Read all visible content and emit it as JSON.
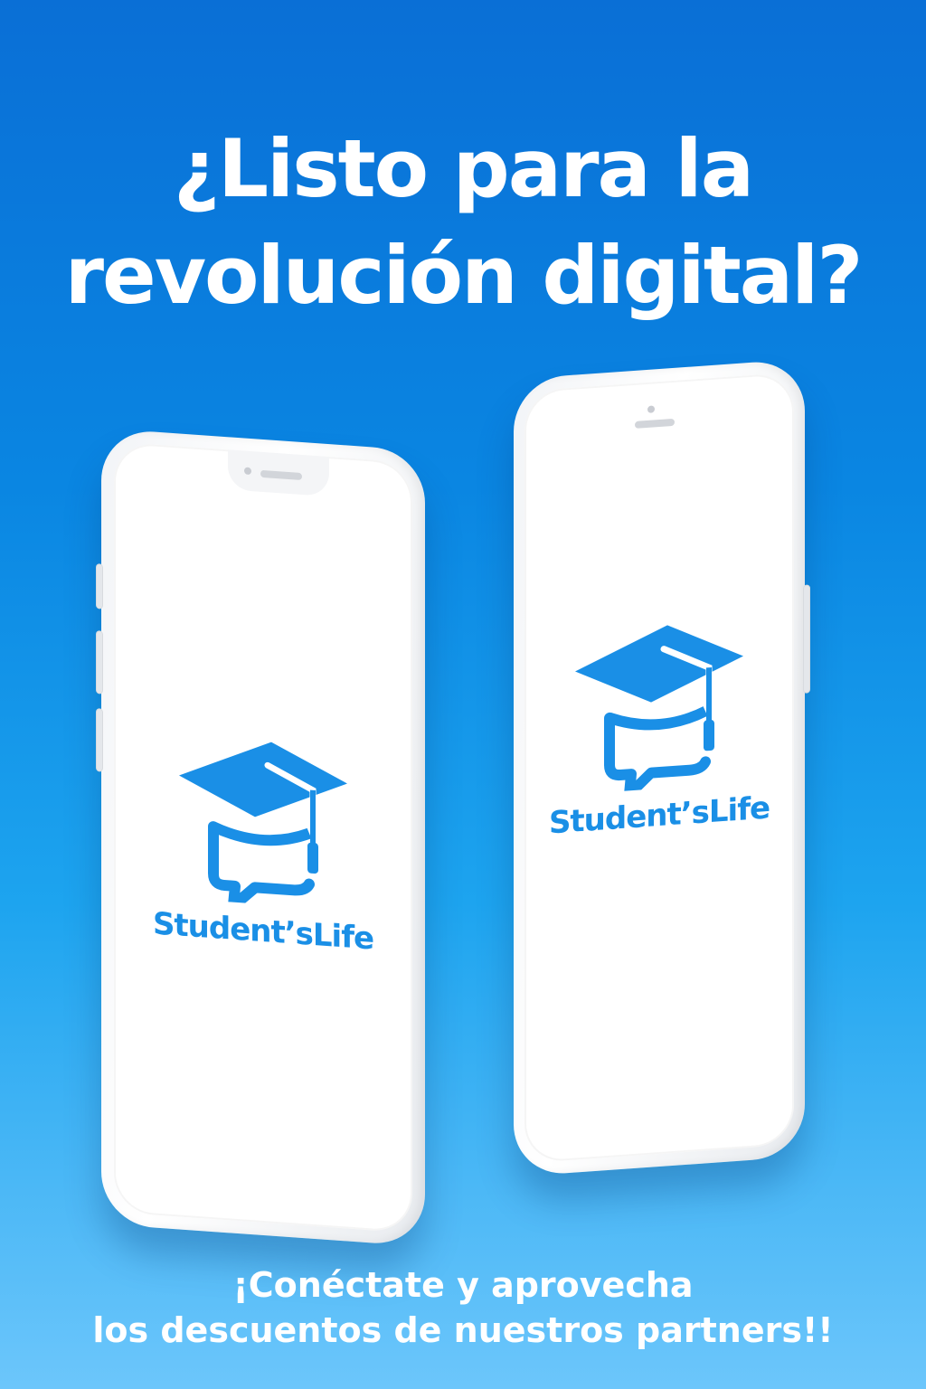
{
  "headline": {
    "line1": "¿Listo para la",
    "line2": "revolución digital?"
  },
  "phones": [
    {
      "brand": "Student’sLife",
      "logo_icon": "graduation-cap-chat-bubble-icon"
    },
    {
      "brand": "Student’sLife",
      "logo_icon": "graduation-cap-chat-bubble-icon"
    }
  ],
  "tagline": {
    "line1": "¡Conéctate y aprovecha",
    "line2": "los descuentos de nuestros partners!!"
  },
  "colors": {
    "background_top": "#0a6fd6",
    "background_bottom": "#6cc6fb",
    "brand_blue": "#1a8fe6",
    "text": "#ffffff"
  }
}
